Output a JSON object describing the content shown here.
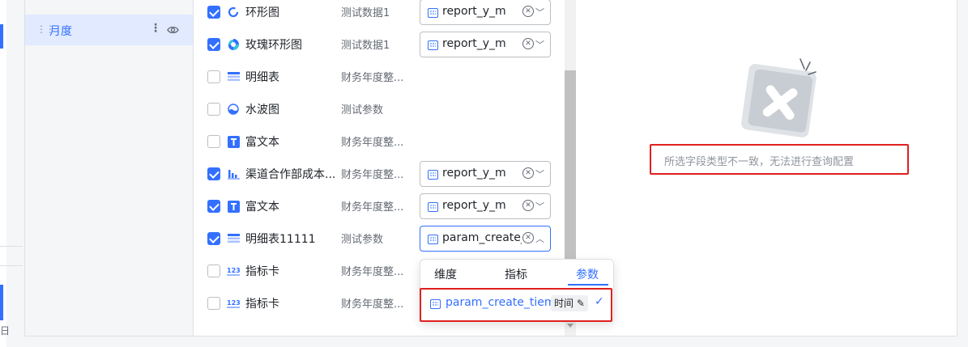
{
  "sidebar": {
    "field_label": "月度"
  },
  "rows": [
    {
      "checked": true,
      "icon": "donut-chart-icon",
      "chart": "环形图",
      "dataset": "测试数据1",
      "field": "report_y_m"
    },
    {
      "checked": true,
      "icon": "rose-donut-chart-icon",
      "chart": "玫瑰环形图",
      "dataset": "测试数据1",
      "field": "report_y_m"
    },
    {
      "checked": false,
      "icon": "detail-table-icon",
      "chart": "明细表",
      "dataset": "财务年度整...",
      "field": ""
    },
    {
      "checked": false,
      "icon": "liquid-chart-icon",
      "chart": "水波图",
      "dataset": "测试参数",
      "field": ""
    },
    {
      "checked": false,
      "icon": "rich-text-icon",
      "chart": "富文本",
      "dataset": "财务年度整...",
      "field": ""
    },
    {
      "checked": true,
      "icon": "bar-chart-icon",
      "chart": "渠道合作部成本...",
      "dataset": "财务年度整...",
      "field": "report_y_m"
    },
    {
      "checked": true,
      "icon": "rich-text-icon",
      "chart": "富文本",
      "dataset": "财务年度整...",
      "field": "report_y_m"
    },
    {
      "checked": true,
      "icon": "detail-table-icon",
      "chart": "明细表11111",
      "dataset": "测试参数",
      "field": "param_create_tiem"
    },
    {
      "checked": false,
      "icon": "indicator-card-icon",
      "chart": "指标卡",
      "dataset": "财务年度整...",
      "field": ""
    },
    {
      "checked": false,
      "icon": "indicator-card-icon",
      "chart": "指标卡",
      "dataset": "财务年度整...",
      "field": ""
    }
  ],
  "dropdown": {
    "tabs": [
      "维度",
      "指标",
      "参数"
    ],
    "active_tab": "参数",
    "option_name": "param_create_tiem",
    "option_tag": "时间"
  },
  "preview": {
    "empty_message": "所选字段类型不一致，无法进行查询配置"
  },
  "edge": {
    "char": "日"
  },
  "colors": {
    "accent": "#3370ff",
    "highlight_box": "#e02020",
    "selected_item_bg": "#e1eaff"
  }
}
